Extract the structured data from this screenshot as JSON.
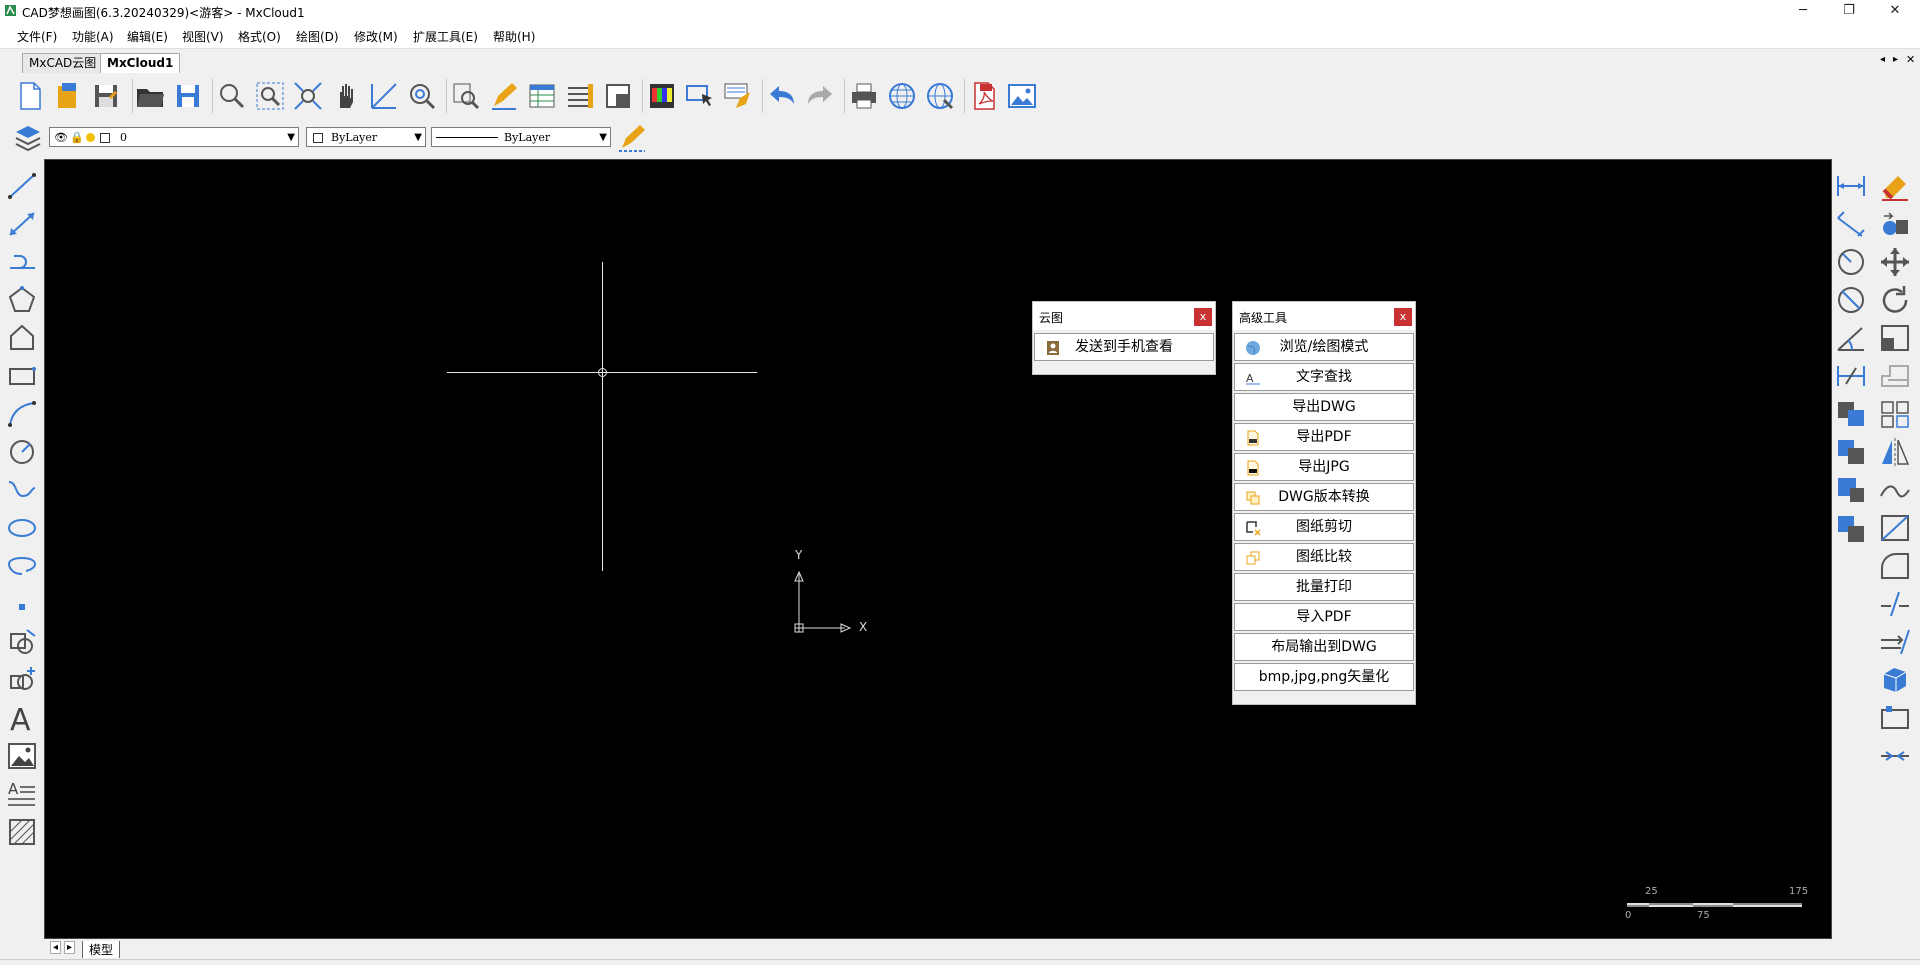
{
  "window": {
    "title": "CAD梦想画图(6.3.20240329)<游客> - MxCloud1",
    "minimize": "─",
    "maximize": "❐",
    "close": "✕"
  },
  "menu": [
    "文件(F)",
    "功能(A)",
    "编辑(E)",
    "视图(V)",
    "格式(O)",
    "绘图(D)",
    "修改(M)",
    "扩展工具(E)",
    "帮助(H)"
  ],
  "tabs": [
    "MxCAD云图",
    "MxCloud1"
  ],
  "tab_controls": {
    "prev": "◂",
    "next": "▸",
    "close": "✕"
  },
  "properties": {
    "layer_value": "0",
    "color_value": "ByLayer",
    "linetype_value": "ByLayer"
  },
  "canvas": {
    "axis_y": "Y",
    "axis_x": "X",
    "background": "#000000",
    "scale_top": [
      "25",
      "175"
    ],
    "scale_bottom": [
      "0",
      "75"
    ]
  },
  "panel_cloud": {
    "title": "云图",
    "close": "x",
    "button": "发送到手机查看"
  },
  "panel_advanced": {
    "title": "高级工具",
    "close": "x",
    "buttons": [
      "浏览/绘图模式",
      "文字查找",
      "导出DWG",
      "导出PDF",
      "导出JPG",
      "DWG版本转换",
      "图纸剪切",
      "图纸比较",
      "批量打印",
      "导入PDF",
      "布局输出到DWG",
      "bmp,jpg,png矢量化"
    ]
  },
  "bottom": {
    "model_tab": "模型"
  },
  "colors": {
    "accent_blue": "#3a7bd5",
    "close_red": "#c83232",
    "icon_orange": "#e8a317"
  }
}
